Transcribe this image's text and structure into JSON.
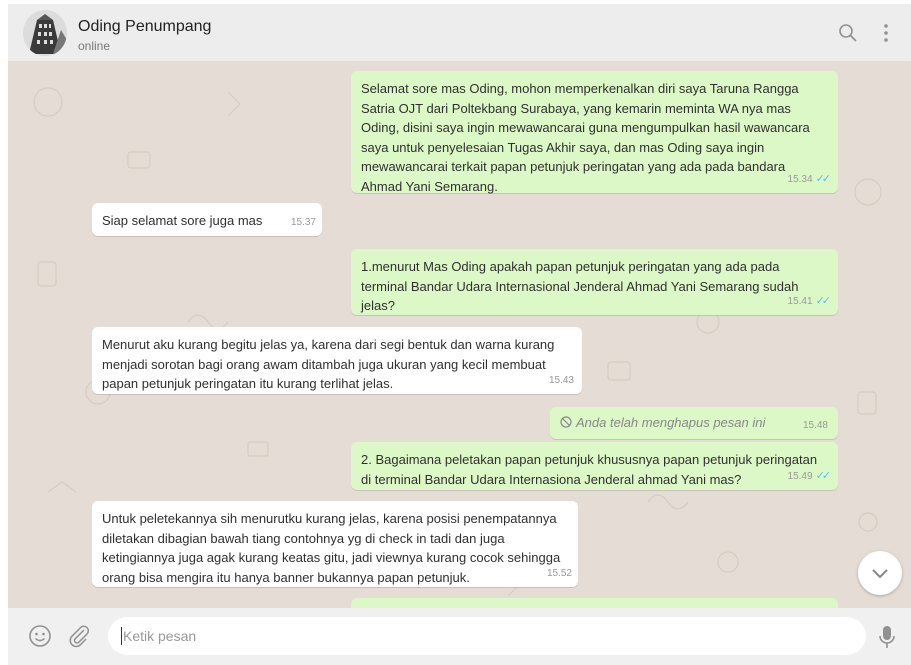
{
  "header": {
    "contact_name": "Oding Penumpang",
    "status": "online",
    "icons": [
      "search-icon",
      "menu-icon"
    ]
  },
  "messages": [
    {
      "direction": "out",
      "text": "Selamat sore mas Oding, mohon memperkenalkan diri saya Taruna Rangga Satria OJT dari Poltekbang Surabaya, yang kemarin meminta WA nya mas Oding, disini saya ingin mewawancarai guna mengumpulkan hasil wawancara saya untuk penyelesaian Tugas Akhir saya, dan mas Oding saya ingin mewawancarai terkait papan petunjuk peringatan yang ada pada bandara Ahmad Yani Semarang.",
      "time": "15.34",
      "status": "read"
    },
    {
      "direction": "in",
      "text": "Siap selamat sore juga mas",
      "time": "15.37"
    },
    {
      "direction": "out",
      "text": "1.menurut Mas Oding apakah papan petunjuk peringatan yang ada pada terminal Bandar Udara Internasional Jenderal Ahmad Yani Semarang sudah jelas?",
      "time": "15.41",
      "status": "read"
    },
    {
      "direction": "in",
      "text": "Menurut aku kurang begitu jelas ya, karena dari segi bentuk dan warna kurang menjadi sorotan bagi orang awam ditambah juga ukuran yang kecil membuat papan petunjuk peringatan itu kurang terlihat jelas.",
      "time": "15.43"
    },
    {
      "direction": "out",
      "deleted": true,
      "text": "Anda telah menghapus pesan ini",
      "time": "15.48"
    },
    {
      "direction": "out",
      "text": "2. Bagaimana peletakan papan petunjuk khususnya papan petunjuk peringatan di terminal Bandar Udara Internasiona Jenderal ahmad Yani mas?",
      "time": "15.49",
      "status": "read"
    },
    {
      "direction": "in",
      "text": "Untuk peletekannya sih menurutku kurang jelas, karena posisi penempatannya diletakan dibagian bawah tiang contohnya yg di check in tadi dan juga ketingiannya juga agak kurang keatas gitu, jadi viewnya kurang cocok sehingga orang bisa mengira itu hanya banner bukannya papan petunjuk.",
      "time": "15.52"
    }
  ],
  "footer": {
    "input_placeholder": "Ketik pesan",
    "icons": [
      "emoji-icon",
      "attach-icon",
      "microphone-icon"
    ]
  },
  "colors": {
    "outgoing_bubble": "#dcf8c6",
    "incoming_bubble": "#ffffff",
    "chat_background": "#e5ddd5",
    "read_ticks": "#4fc3f7"
  }
}
